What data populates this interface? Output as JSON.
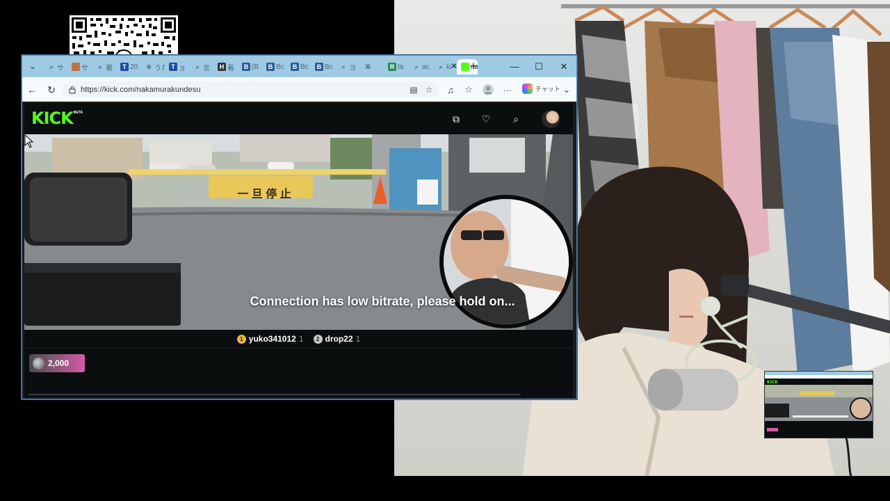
{
  "browser": {
    "tabs": [
      {
        "favicon": "search-icon",
        "label": "サ",
        "fav_color": "#4b6878",
        "fav_text": "⌕"
      },
      {
        "favicon": "avatar-icon",
        "label": "サ",
        "fav_color": "#c0704a",
        "fav_text": ""
      },
      {
        "favicon": "search-icon",
        "label": "著",
        "fav_color": "#4b6878",
        "fav_text": "⌕"
      },
      {
        "favicon": "t-icon",
        "label": "20",
        "fav_color": "#1d4fa0",
        "fav_text": "T"
      },
      {
        "favicon": "globe-icon",
        "label": "うた",
        "fav_color": "#4b6878",
        "fav_text": "⊕"
      },
      {
        "favicon": "t-icon",
        "label": "ョ",
        "fav_color": "#1d4fa0",
        "fav_text": "T"
      },
      {
        "favicon": "search-icon",
        "label": "言",
        "fav_color": "#4b6878",
        "fav_text": "⌕"
      },
      {
        "favicon": "h-icon",
        "label": "着",
        "fav_color": "#333",
        "fav_text": "H"
      },
      {
        "favicon": "b-icon",
        "label": "(B",
        "fav_color": "#2a5c9a",
        "fav_text": "B"
      },
      {
        "favicon": "b-icon",
        "label": "Bc",
        "fav_color": "#2a5c9a",
        "fav_text": "B"
      },
      {
        "favicon": "b-icon",
        "label": "Bc",
        "fav_color": "#2a5c9a",
        "fav_text": "B"
      },
      {
        "favicon": "b-icon",
        "label": "Bc",
        "fav_color": "#2a5c9a",
        "fav_text": "B"
      },
      {
        "favicon": "search-icon",
        "label": "ヨ",
        "fav_color": "#4b6878",
        "fav_text": "⌕"
      },
      {
        "favicon": "code-icon",
        "label": "",
        "fav_color": "#4b6878",
        "fav_text": "⌘"
      },
      {
        "favicon": "r-icon",
        "label": "ta",
        "fav_color": "#2b8a57",
        "fav_text": "R"
      },
      {
        "favicon": "search-icon",
        "label": "ac",
        "fav_color": "#4b6878",
        "fav_text": "⌕"
      },
      {
        "favicon": "search-icon",
        "label": "ki",
        "fav_color": "#4b6878",
        "fav_text": "⌕"
      }
    ],
    "active_tab_label": "na",
    "url": "https://kick.com/nakamurakundesu",
    "copilot_label": "チャット",
    "glyphs": {
      "tab_dropdown": "⌄",
      "tab_close": "✕",
      "new_tab": "+",
      "minimize": "—",
      "maximize": "☐",
      "close": "✕",
      "back": "←",
      "refresh": "↻",
      "read": "▤",
      "favorite": "☆",
      "extensions": "♫",
      "collections": "☆",
      "more": "···",
      "chevron": "⌄"
    }
  },
  "kick": {
    "logo_text": "KICK",
    "beta_label": "BETA",
    "header_icons": {
      "browse": "⧉",
      "follow": "♡",
      "search": "⌕"
    },
    "status_message": "Connection has low bitrate, please hold on...",
    "sign_text": "一 旦 停 止",
    "top_gifters": [
      {
        "rank": "1",
        "name": "yuko341012",
        "count": "1",
        "rank_color": "#e8b73a"
      },
      {
        "rank": "2",
        "name": "drop22",
        "count": "1",
        "rank_color": "#c8c8c8"
      }
    ],
    "kicks_amount": "2,000"
  }
}
